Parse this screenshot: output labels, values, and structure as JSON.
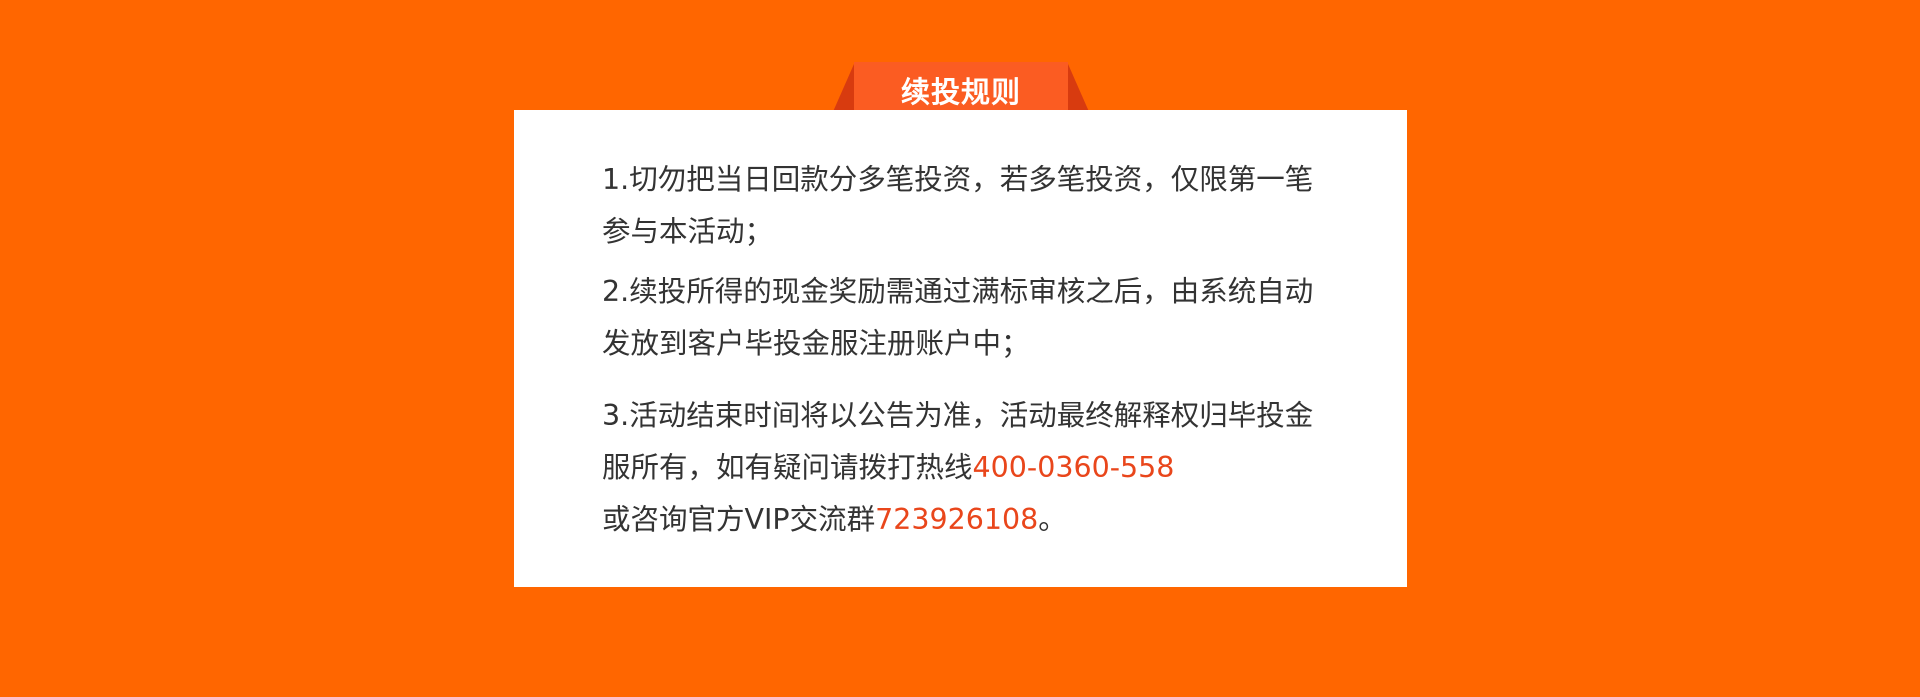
{
  "header": {
    "title": "续投规则"
  },
  "rules": [
    {
      "text": "1.切勿把当日回款分多笔投资，若多笔投资，仅限第一笔参与本活动；"
    },
    {
      "text": "2.续投所得的现金奖励需通过满标审核之后，由系统自动发放到客户毕投金服注册账户中；"
    },
    {
      "text_before_phone": "3.活动结束时间将以公告为准，活动最终解释权归毕投金服所有，如有疑问请拨打热线",
      "phone": "400-0360-558",
      "text_before_group": "或咨询官方VIP交流群",
      "group_number": "723926108",
      "text_end": "。"
    }
  ],
  "colors": {
    "background": "#ff6600",
    "card": "#ffffff",
    "ribbon_front": "#fb5c22",
    "ribbon_side": "#d83b0f",
    "highlight": "#e9461b",
    "text": "#333333"
  }
}
